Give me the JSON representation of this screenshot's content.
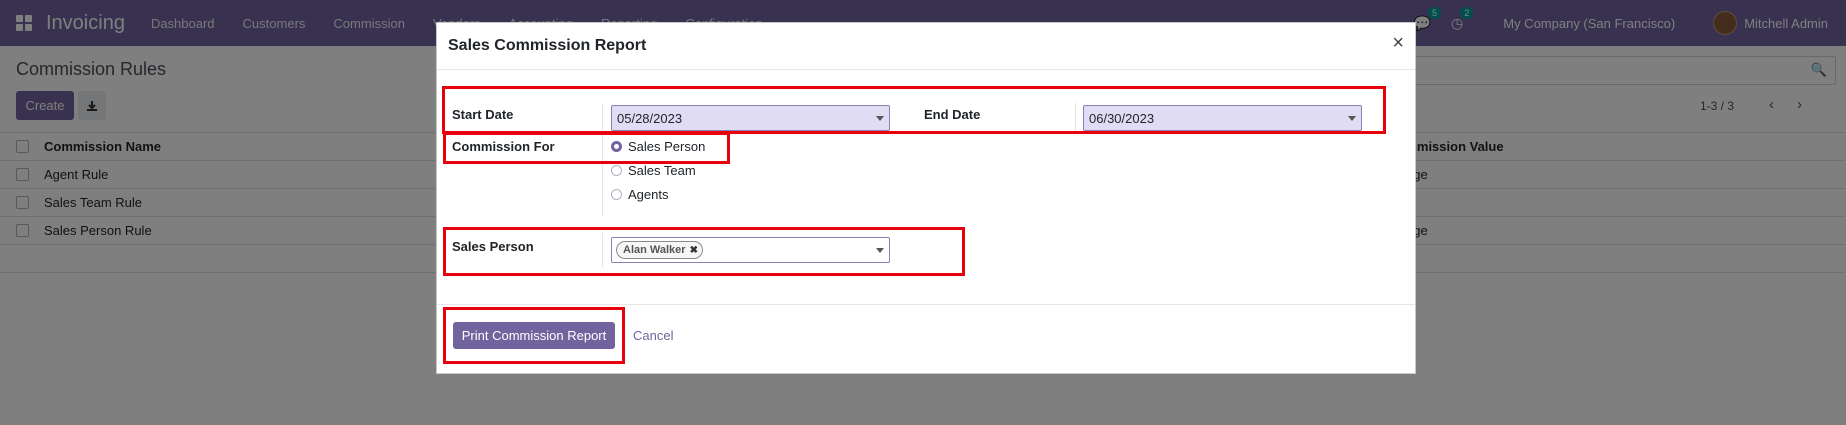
{
  "navbar": {
    "app_name": "Invoicing",
    "menu": [
      "Dashboard",
      "Customers",
      "Commission",
      "Vendors",
      "Accounting",
      "Reporting",
      "Configuration"
    ],
    "messages_badge": "5",
    "activity_badge": "2",
    "company": "My Company (San Francisco)",
    "user": "Mitchell Admin",
    "brand_color": "#71639e"
  },
  "control_panel": {
    "title": "Commission Rules",
    "create_label": "Create",
    "pager": "1-3 / 3"
  },
  "list": {
    "headers": [
      "Commission Name",
      "Commission Value"
    ],
    "rows": [
      {
        "name": "Agent Rule",
        "value": "entage"
      },
      {
        "name": "Sales Team Rule",
        "value": ""
      },
      {
        "name": "Sales Person Rule",
        "value": "entage"
      }
    ]
  },
  "modal": {
    "title": "Sales Commission Report",
    "close": "×",
    "start_date_label": "Start Date",
    "start_date": "05/28/2023",
    "end_date_label": "End Date",
    "end_date": "06/30/2023",
    "commission_for_label": "Commission For",
    "options": [
      "Sales Person",
      "Sales Team",
      "Agents"
    ],
    "selected_option": "Sales Person",
    "sales_person_label": "Sales Person",
    "sales_person_tag": "Alan Walker",
    "print_label": "Print Commission Report",
    "cancel_label": "Cancel"
  },
  "highlight_color": "#e8000d"
}
